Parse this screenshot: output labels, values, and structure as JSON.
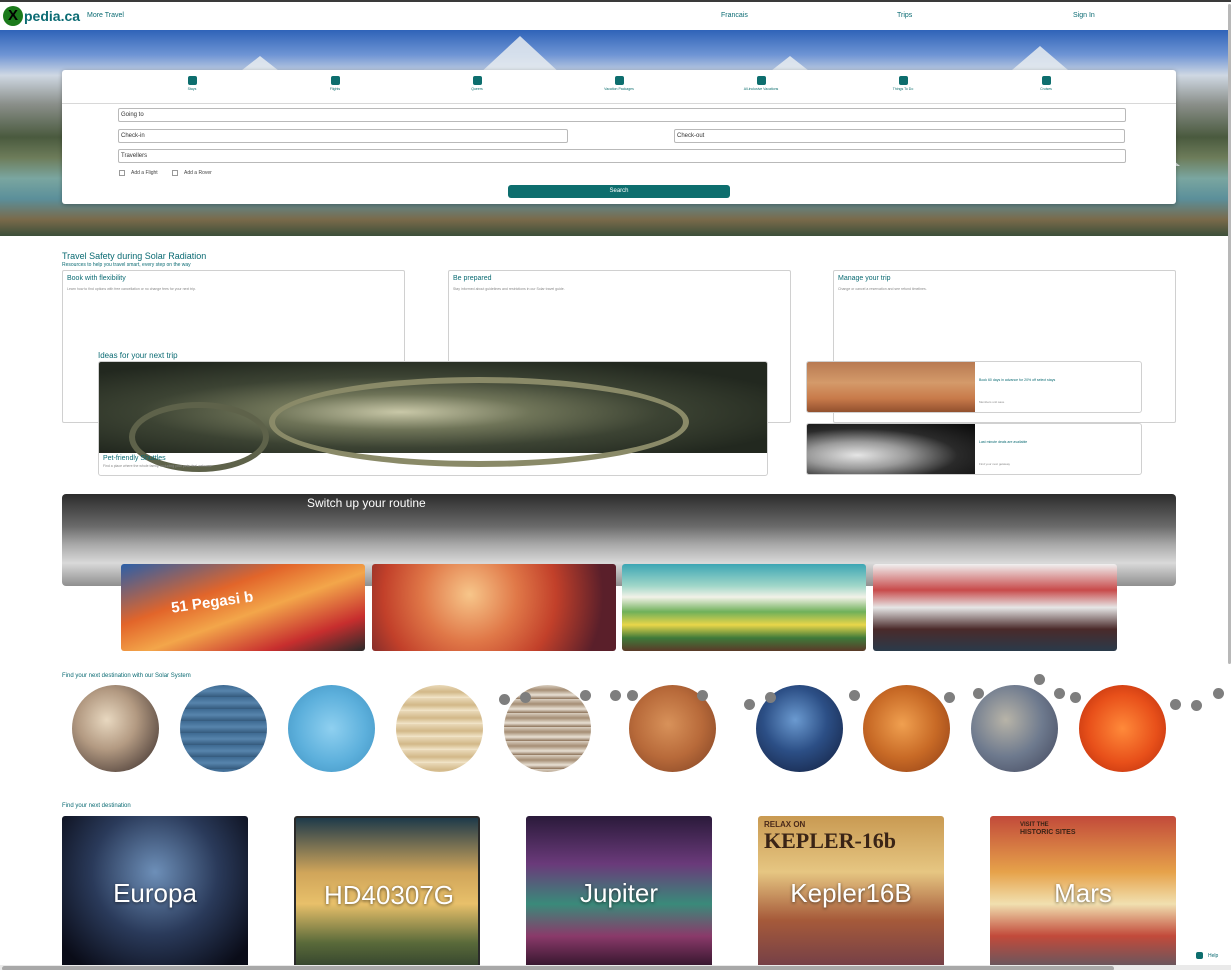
{
  "nav": {
    "logo_letter": "X",
    "logo_text": "pedia.ca",
    "more_travel": "More Travel",
    "language": "Francais",
    "trips": "Trips",
    "sign_in": "Sign In"
  },
  "search": {
    "tabs": [
      {
        "label": "Stays",
        "icon": "bed-icon"
      },
      {
        "label": "Flights",
        "icon": "plane-icon"
      },
      {
        "label": "Queers",
        "icon": "car-icon"
      },
      {
        "label": "Vacation Packages",
        "icon": "package-icon"
      },
      {
        "label": "All-inclusive Vacations",
        "icon": "resort-icon"
      },
      {
        "label": "Things To Do",
        "icon": "ticket-icon"
      },
      {
        "label": "Cruises",
        "icon": "ship-icon"
      }
    ],
    "going_to": "Going to",
    "check_in": "Check-in",
    "check_out": "Check-out",
    "travellers": "Travellers",
    "add_flight": "Add a Flight",
    "add_rover": "Add a Rover",
    "button": "Search"
  },
  "safety": {
    "title": "Travel Safety during Solar Radiation",
    "subtitle": "Resources to help you travel smart, every step on the way",
    "cards": [
      {
        "title": "Book with flexibility",
        "desc": "Learn how to find options with free cancellation or no change fees for your next trip."
      },
      {
        "title": "Be prepared",
        "desc": "Stay informed about guidelines and restrictions in our Solar travel guide."
      },
      {
        "title": "Manage your trip",
        "desc": "Change or cancel a reservation and see refund timelines."
      }
    ]
  },
  "ideas": {
    "title": "Ideas for your next trip",
    "main": {
      "title": "Pet-friendly Shuttles",
      "desc": "Find a place where the whole family, including your pets, feel welcome"
    },
    "side": [
      {
        "title": "Book 60 days in advance for 20% off select stays",
        "desc": "Members unit save"
      },
      {
        "title": "Last minute deals are available",
        "desc": "Find your next getaway"
      }
    ]
  },
  "switch": {
    "title": "Switch up your routine",
    "poster_text": "51 Pegasi b"
  },
  "solar": {
    "title": "Find your next destination with our Solar System",
    "planets": [
      "pluto",
      "neptune",
      "uranus",
      "saturn",
      "jupiter",
      "mars",
      "earth",
      "venus",
      "mercury",
      "sun"
    ]
  },
  "destinations": {
    "title": "Find your next destination",
    "items": [
      "Europa",
      "HD40307G",
      "Jupiter",
      "Kepler16B",
      "Mars"
    ],
    "kepler_poster_top": "RELAX ON",
    "kepler_poster_main": "KEPLER-16b",
    "mars_poster_top": "VISIT THE",
    "mars_poster_sub": "HISTORIC SITES"
  },
  "help": "Help"
}
